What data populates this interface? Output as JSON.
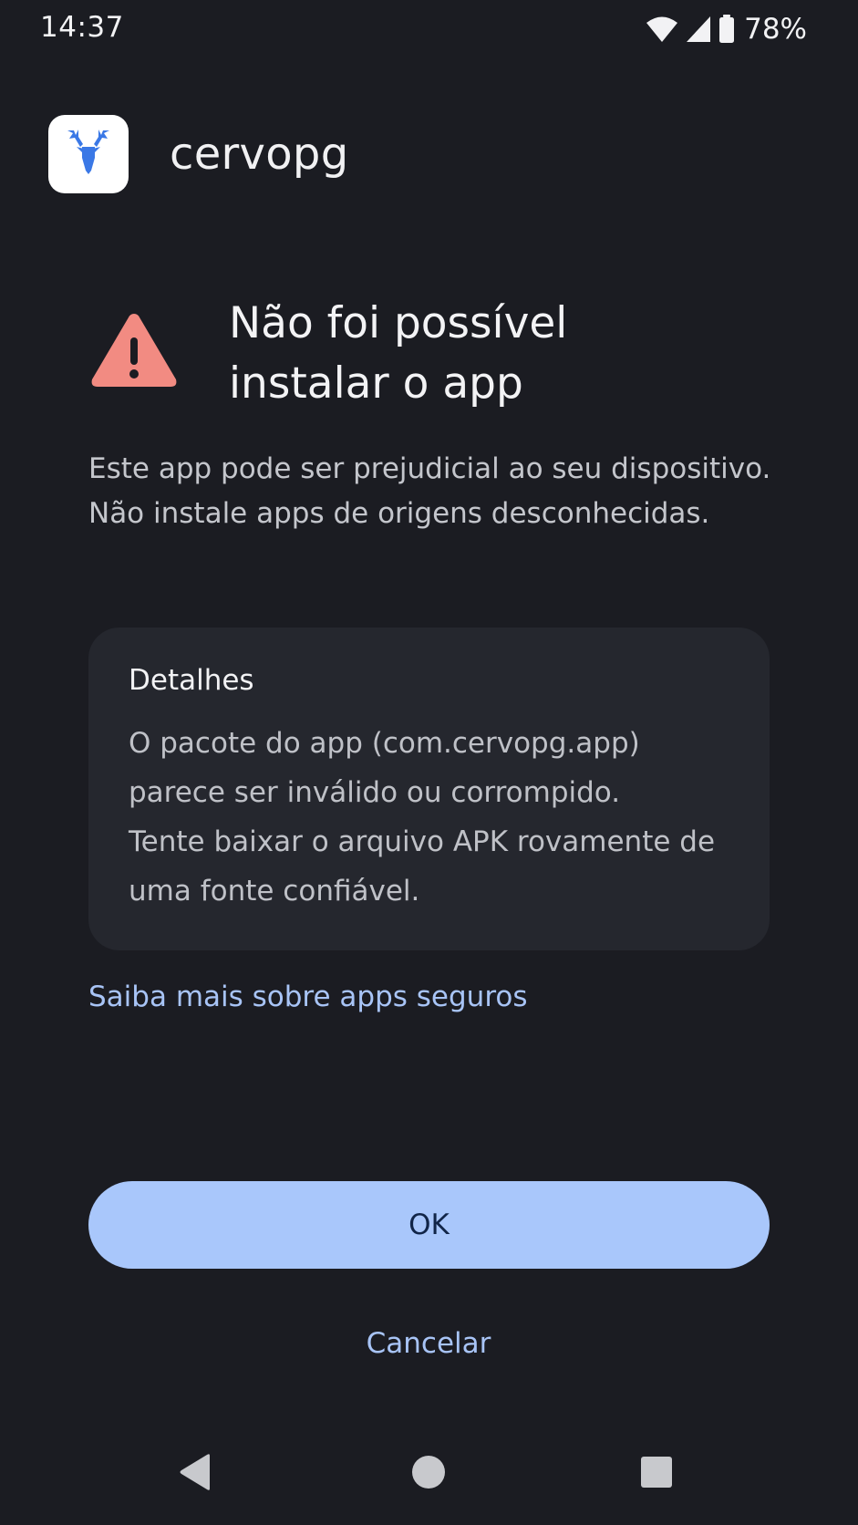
{
  "status_bar": {
    "time": "14:37",
    "battery": "78%",
    "icons": [
      "wifi-icon",
      "signal-icon",
      "battery-icon"
    ]
  },
  "app": {
    "name": "cervopg",
    "icon": "deer-head-icon"
  },
  "dialog": {
    "title": "Não foi possível\ninstalar o app",
    "warning_icon": "warning-triangle-icon",
    "description": "Este app pode ser prejudicial ao seu dispositivo. Não instale apps de origens desconhecidas.",
    "details": {
      "title": "Detalhes",
      "line1": "O pacote do app (com.cervopg.app) parece ser inválido ou corrompido.",
      "line2": "Tente baixar o arquivo APK rovamente de uma fonte confiável."
    },
    "learn_more_link": "Saiba mais sobre apps seguros",
    "ok_button": "OK",
    "cancel_button": "Cancelar"
  },
  "nav_bar": {
    "buttons": [
      "back-icon",
      "home-icon",
      "recents-icon"
    ]
  },
  "colors": {
    "background": "#1b1c22",
    "card": "#25272e",
    "accent": "#a9c7fb",
    "link": "#a8c4f6",
    "warning": "#f28b82"
  }
}
